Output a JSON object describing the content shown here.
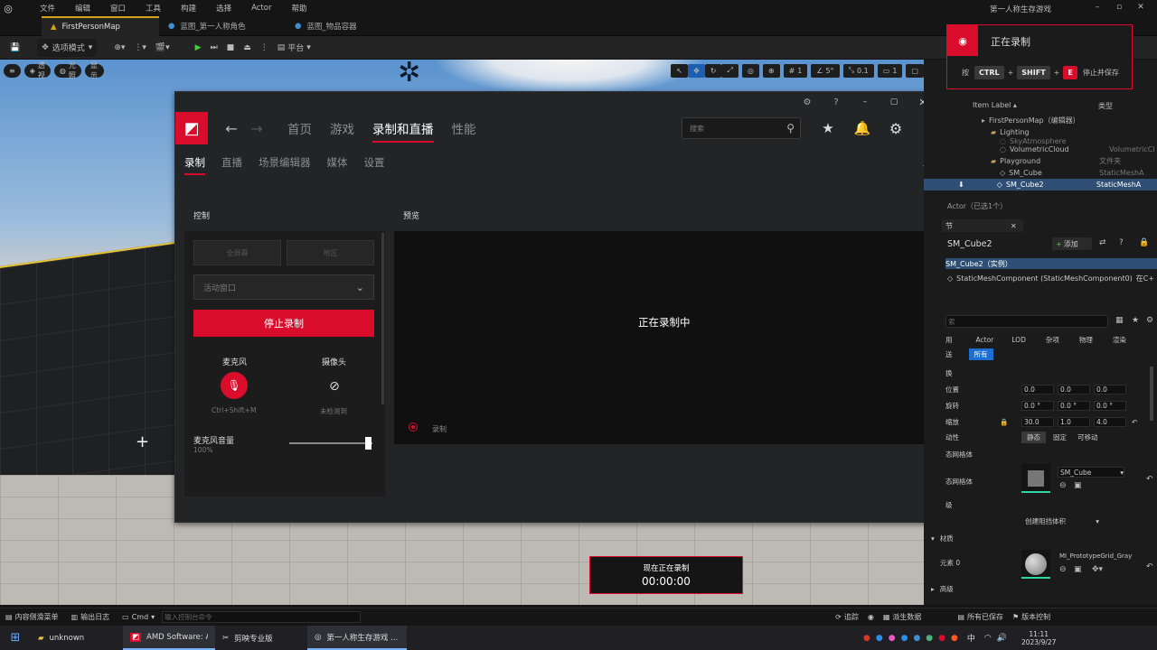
{
  "menu": {
    "items": [
      "文件",
      "编辑",
      "窗口",
      "工具",
      "构建",
      "选择",
      "Actor",
      "帮助"
    ],
    "project_title": "第一人称生存游戏"
  },
  "doc_tabs": [
    "FirstPersonMap",
    "蓝图_第一人称角色",
    "蓝图_物品容器"
  ],
  "toolbar": {
    "mode_label": "选项模式",
    "platform_label": "平台"
  },
  "viewport": {
    "view_labels": [
      "透视",
      "光照",
      "显示"
    ],
    "snap_values": [
      "1",
      "5°",
      "0.1",
      "1"
    ]
  },
  "amd": {
    "top_icons": [
      "bug-icon",
      "help-icon",
      "minimize-icon",
      "maximize-icon",
      "close-icon"
    ],
    "nav": [
      "首页",
      "游戏",
      "录制和直播",
      "性能"
    ],
    "search_placeholder": "搜索",
    "subnav": [
      "录制",
      "直播",
      "场景编辑器",
      "媒体",
      "设置"
    ],
    "control": {
      "title": "控制",
      "dim_buttons": [
        "全屏幕",
        "地区"
      ],
      "capture_target": "活动窗口",
      "stop_label": "停止录制",
      "mic_label": "麦克风",
      "mic_hotkey": "Ctrl+Shift+M",
      "cam_label": "摄像头",
      "cam_status": "未检测到",
      "volume_label": "麦克风音量",
      "volume_value": "100%",
      "volume_fraction": 1.0
    },
    "preview": {
      "title": "预览",
      "status": "正在录制中",
      "rec_label": "录制",
      "timer_label": "现在正在录制",
      "timer_value": "00:00:00"
    }
  },
  "toast": {
    "title": "正在录制",
    "press": "按",
    "keys": [
      "CTRL",
      "SHIFT",
      "E"
    ],
    "action": "停止并保存"
  },
  "outliner": {
    "col_label": "Item Label ▴",
    "col_type": "类型",
    "rows": [
      {
        "label": "FirstPersonMap（编辑器）",
        "type": ""
      },
      {
        "label": "Lighting",
        "type": ""
      },
      {
        "label": "SkyAtmosphere",
        "type": ""
      },
      {
        "label": "VolumetricCloud",
        "type": "VolumetricCl"
      },
      {
        "label": "Playground",
        "type": "文件夹"
      },
      {
        "label": "SM_Cube",
        "type": "StaticMeshA"
      },
      {
        "label": "SM_Cube2",
        "type": "StaticMeshA"
      }
    ],
    "footer": "Actor（已选1个）"
  },
  "details": {
    "tab": "节",
    "name": "SM_Cube2",
    "add_label": "添加",
    "instance": "SM_Cube2（实例）",
    "component": "StaticMeshComponent (StaticMeshComponent0)",
    "component_link": "在C+",
    "search_placeholder": "索",
    "filters": [
      "用",
      "Actor",
      "LOD",
      "杂项",
      "物理",
      "渲染"
    ],
    "filters2": [
      "送",
      "所有"
    ],
    "section_transform": "换",
    "loc_label": "位置",
    "rot_label": "旋转",
    "scale_label": "缩放",
    "loc": [
      "0.0",
      "0.0",
      "0.0"
    ],
    "rot": [
      "0.0 °",
      "0.0 °",
      "0.0 °"
    ],
    "scale": [
      "30.0",
      "1.0",
      "4.0"
    ],
    "mobility_label": "动性",
    "mobility": [
      "静态",
      "固定",
      "可移动"
    ],
    "section_mesh": "态网格体",
    "mesh_label": "态网格体",
    "mesh_value": "SM_Cube",
    "lod_label": "级",
    "collision_value": "创建阻挡体积",
    "section_material": "材质",
    "element_label": "元素 0",
    "material_value": "MI_PrototypeGrid_Gray",
    "advanced": "高级"
  },
  "statusbar": {
    "content_drawer": "内容侧滑菜单",
    "output_log": "输出日志",
    "cmd": "Cmd",
    "console_placeholder": "输入控制台命令",
    "trace": "追踪",
    "derived": "派生数据",
    "saved": "所有已保存",
    "vcs": "版本控制"
  },
  "taskbar": {
    "apps": [
      "unknown",
      "AMD Software: A...",
      "剪映专业版",
      "第一人称生存游戏 ..."
    ],
    "ime": "中",
    "time": "11:11",
    "date": "2023/9/27"
  },
  "colors": {
    "amd_red": "#d90c2c",
    "ue_selection": "#2e4e73",
    "ue_gold": "#d6a21a"
  }
}
